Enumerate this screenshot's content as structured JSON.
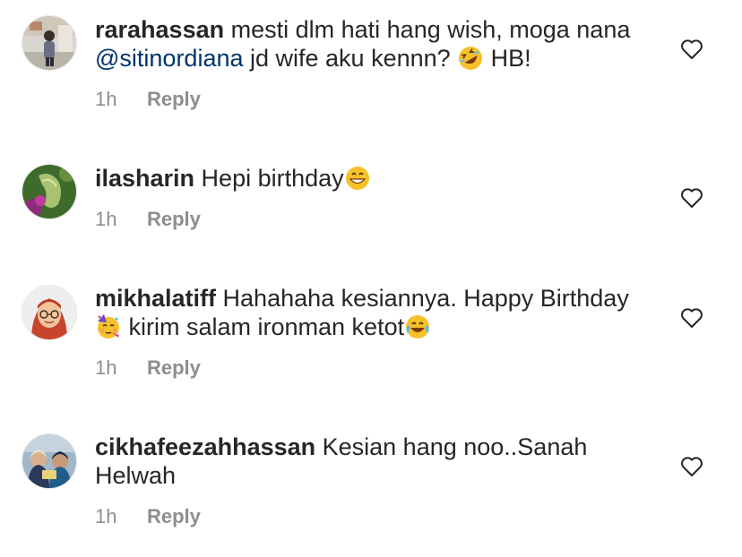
{
  "comments": [
    {
      "username": "rarahassan",
      "text_before": " mesti dlm hati hang wish, moga nana ",
      "mention": "@sitinordiana",
      "text_after": " jd wife aku kennn? ",
      "emoji": "rolling-on-floor-laughing",
      "text_tail": " HB!",
      "time": "1h",
      "reply_label": "Reply"
    },
    {
      "username": "ilasharin",
      "text": " Hepi birthday",
      "emoji": "grinning-face",
      "time": "1h",
      "reply_label": "Reply"
    },
    {
      "username": "mikhalatiff",
      "text": " Hahahaha kesiannya. Happy Birthday ",
      "emoji": "partying-face",
      "text_after": " kirim salam ironman ketot",
      "emoji2": "face-with-tears-of-joy",
      "time": "1h",
      "reply_label": "Reply"
    },
    {
      "username": "cikhafeezahhassan",
      "text": " Kesian hang noo..Sanah Helwah",
      "time": "1h",
      "reply_label": "Reply"
    }
  ],
  "colors": {
    "text": "#262626",
    "meta": "#8e8e8e",
    "mention": "#003569"
  }
}
